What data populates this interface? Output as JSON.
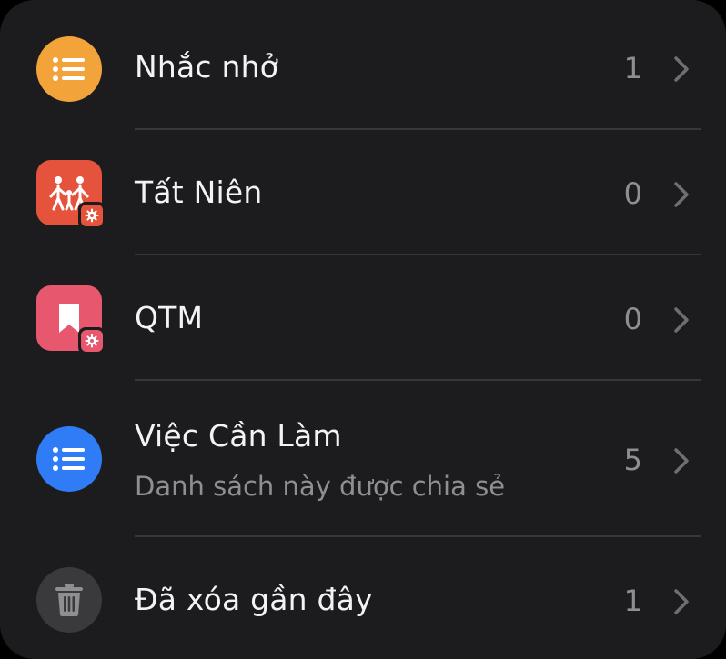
{
  "lists": [
    {
      "title": "Nhắc nhở",
      "subtitle": "",
      "count": "1",
      "icon": "list-bullet-icon",
      "color": "#f2a33a",
      "shape": "circle",
      "shared": false
    },
    {
      "title": "Tất Niên",
      "subtitle": "",
      "count": "0",
      "icon": "family-icon",
      "color": "#e5533d",
      "shape": "square",
      "shared": false
    },
    {
      "title": "QTM",
      "subtitle": "",
      "count": "0",
      "icon": "bookmark-icon",
      "color": "#e7586e",
      "shape": "square",
      "shared": false
    },
    {
      "title": "Việc Cần Làm",
      "subtitle": "Danh sách này được chia sẻ",
      "count": "5",
      "icon": "list-bullet-icon",
      "color": "#2f7cf6",
      "shape": "circle",
      "shared": true
    },
    {
      "title": "Đã xóa gần đây",
      "subtitle": "",
      "count": "1",
      "icon": "trash-icon",
      "color": "#3a3a3c",
      "shape": "circle",
      "shared": false
    }
  ],
  "colors": {
    "background": "#1c1c1e",
    "text": "#f2f2f7",
    "secondary_text": "#8e8e93",
    "divider": "#38383a"
  }
}
